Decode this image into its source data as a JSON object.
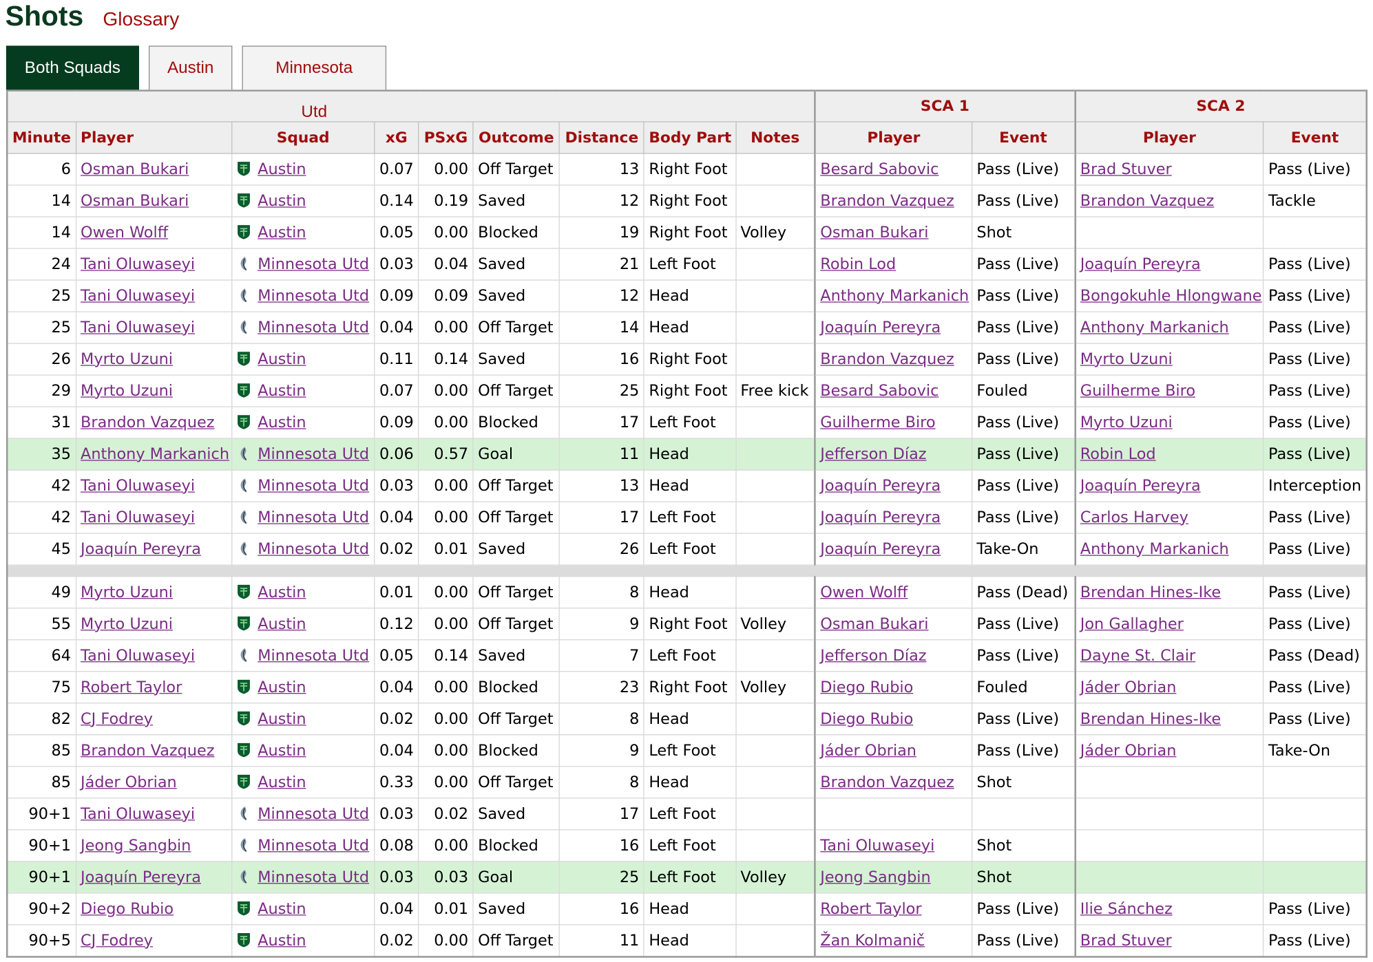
{
  "header": {
    "title": "Shots",
    "glossary": "Glossary"
  },
  "tabs": [
    "Both Squads",
    "Austin",
    "Minnesota Utd"
  ],
  "table": {
    "groups": {
      "sca1": "SCA 1",
      "sca2": "SCA 2"
    },
    "columns": [
      "Minute",
      "Player",
      "Squad",
      "xG",
      "PSxG",
      "Outcome",
      "Distance",
      "Body Part",
      "Notes",
      "Player",
      "Event",
      "Player",
      "Event"
    ],
    "colors": {
      "austin": "#0b5b2e",
      "minnesota": "#8a9aa8",
      "goal_row": "#d5f2d5"
    },
    "rows_first_half": [
      {
        "minute": "6",
        "player": "Osman Bukari",
        "squad": "Austin",
        "xg": "0.07",
        "psxg": "0.00",
        "outcome": "Off Target",
        "distance": "13",
        "body": "Right Foot",
        "notes": "",
        "sca1_player": "Besard Sabovic",
        "sca1_event": "Pass (Live)",
        "sca2_player": "Brad Stuver",
        "sca2_event": "Pass (Live)"
      },
      {
        "minute": "14",
        "player": "Osman Bukari",
        "squad": "Austin",
        "xg": "0.14",
        "psxg": "0.19",
        "outcome": "Saved",
        "distance": "12",
        "body": "Right Foot",
        "notes": "",
        "sca1_player": "Brandon Vazquez",
        "sca1_event": "Pass (Live)",
        "sca2_player": "Brandon Vazquez",
        "sca2_event": "Tackle"
      },
      {
        "minute": "14",
        "player": "Owen Wolff",
        "squad": "Austin",
        "xg": "0.05",
        "psxg": "0.00",
        "outcome": "Blocked",
        "distance": "19",
        "body": "Right Foot",
        "notes": "Volley",
        "sca1_player": "Osman Bukari",
        "sca1_event": "Shot",
        "sca2_player": "",
        "sca2_event": ""
      },
      {
        "minute": "24",
        "player": "Tani Oluwaseyi",
        "squad": "Minnesota Utd",
        "xg": "0.03",
        "psxg": "0.04",
        "outcome": "Saved",
        "distance": "21",
        "body": "Left Foot",
        "notes": "",
        "sca1_player": "Robin Lod",
        "sca1_event": "Pass (Live)",
        "sca2_player": "Joaquín Pereyra",
        "sca2_event": "Pass (Live)"
      },
      {
        "minute": "25",
        "player": "Tani Oluwaseyi",
        "squad": "Minnesota Utd",
        "xg": "0.09",
        "psxg": "0.09",
        "outcome": "Saved",
        "distance": "12",
        "body": "Head",
        "notes": "",
        "sca1_player": "Anthony Markanich",
        "sca1_event": "Pass (Live)",
        "sca2_player": "Bongokuhle Hlongwane",
        "sca2_event": "Pass (Live)"
      },
      {
        "minute": "25",
        "player": "Tani Oluwaseyi",
        "squad": "Minnesota Utd",
        "xg": "0.04",
        "psxg": "0.00",
        "outcome": "Off Target",
        "distance": "14",
        "body": "Head",
        "notes": "",
        "sca1_player": "Joaquín Pereyra",
        "sca1_event": "Pass (Live)",
        "sca2_player": "Anthony Markanich",
        "sca2_event": "Pass (Live)"
      },
      {
        "minute": "26",
        "player": "Myrto Uzuni",
        "squad": "Austin",
        "xg": "0.11",
        "psxg": "0.14",
        "outcome": "Saved",
        "distance": "16",
        "body": "Right Foot",
        "notes": "",
        "sca1_player": "Brandon Vazquez",
        "sca1_event": "Pass (Live)",
        "sca2_player": "Myrto Uzuni",
        "sca2_event": "Pass (Live)"
      },
      {
        "minute": "29",
        "player": "Myrto Uzuni",
        "squad": "Austin",
        "xg": "0.07",
        "psxg": "0.00",
        "outcome": "Off Target",
        "distance": "25",
        "body": "Right Foot",
        "notes": "Free kick",
        "sca1_player": "Besard Sabovic",
        "sca1_event": "Fouled",
        "sca2_player": "Guilherme Biro",
        "sca2_event": "Pass (Live)"
      },
      {
        "minute": "31",
        "player": "Brandon Vazquez",
        "squad": "Austin",
        "xg": "0.09",
        "psxg": "0.00",
        "outcome": "Blocked",
        "distance": "17",
        "body": "Left Foot",
        "notes": "",
        "sca1_player": "Guilherme Biro",
        "sca1_event": "Pass (Live)",
        "sca2_player": "Myrto Uzuni",
        "sca2_event": "Pass (Live)"
      },
      {
        "minute": "35",
        "player": "Anthony Markanich",
        "squad": "Minnesota Utd",
        "xg": "0.06",
        "psxg": "0.57",
        "outcome": "Goal",
        "distance": "11",
        "body": "Head",
        "notes": "",
        "sca1_player": "Jefferson Díaz",
        "sca1_event": "Pass (Live)",
        "sca2_player": "Robin Lod",
        "sca2_event": "Pass (Live)"
      },
      {
        "minute": "42",
        "player": "Tani Oluwaseyi",
        "squad": "Minnesota Utd",
        "xg": "0.03",
        "psxg": "0.00",
        "outcome": "Off Target",
        "distance": "13",
        "body": "Head",
        "notes": "",
        "sca1_player": "Joaquín Pereyra",
        "sca1_event": "Pass (Live)",
        "sca2_player": "Joaquín Pereyra",
        "sca2_event": "Interception"
      },
      {
        "minute": "42",
        "player": "Tani Oluwaseyi",
        "squad": "Minnesota Utd",
        "xg": "0.04",
        "psxg": "0.00",
        "outcome": "Off Target",
        "distance": "17",
        "body": "Left Foot",
        "notes": "",
        "sca1_player": "Joaquín Pereyra",
        "sca1_event": "Pass (Live)",
        "sca2_player": "Carlos Harvey",
        "sca2_event": "Pass (Live)"
      },
      {
        "minute": "45",
        "player": "Joaquín Pereyra",
        "squad": "Minnesota Utd",
        "xg": "0.02",
        "psxg": "0.01",
        "outcome": "Saved",
        "distance": "26",
        "body": "Left Foot",
        "notes": "",
        "sca1_player": "Joaquín Pereyra",
        "sca1_event": "Take-On",
        "sca2_player": "Anthony Markanich",
        "sca2_event": "Pass (Live)"
      }
    ],
    "rows_second_half": [
      {
        "minute": "49",
        "player": "Myrto Uzuni",
        "squad": "Austin",
        "xg": "0.01",
        "psxg": "0.00",
        "outcome": "Off Target",
        "distance": "8",
        "body": "Head",
        "notes": "",
        "sca1_player": "Owen Wolff",
        "sca1_event": "Pass (Dead)",
        "sca2_player": "Brendan Hines-Ike",
        "sca2_event": "Pass (Live)"
      },
      {
        "minute": "55",
        "player": "Myrto Uzuni",
        "squad": "Austin",
        "xg": "0.12",
        "psxg": "0.00",
        "outcome": "Off Target",
        "distance": "9",
        "body": "Right Foot",
        "notes": "Volley",
        "sca1_player": "Osman Bukari",
        "sca1_event": "Pass (Live)",
        "sca2_player": "Jon Gallagher",
        "sca2_event": "Pass (Live)"
      },
      {
        "minute": "64",
        "player": "Tani Oluwaseyi",
        "squad": "Minnesota Utd",
        "xg": "0.05",
        "psxg": "0.14",
        "outcome": "Saved",
        "distance": "7",
        "body": "Left Foot",
        "notes": "",
        "sca1_player": "Jefferson Díaz",
        "sca1_event": "Pass (Live)",
        "sca2_player": "Dayne St. Clair",
        "sca2_event": "Pass (Dead)"
      },
      {
        "minute": "75",
        "player": "Robert Taylor",
        "squad": "Austin",
        "xg": "0.04",
        "psxg": "0.00",
        "outcome": "Blocked",
        "distance": "23",
        "body": "Right Foot",
        "notes": "Volley",
        "sca1_player": "Diego Rubio",
        "sca1_event": "Fouled",
        "sca2_player": "Jáder Obrian",
        "sca2_event": "Pass (Live)"
      },
      {
        "minute": "82",
        "player": "CJ Fodrey",
        "squad": "Austin",
        "xg": "0.02",
        "psxg": "0.00",
        "outcome": "Off Target",
        "distance": "8",
        "body": "Head",
        "notes": "",
        "sca1_player": "Diego Rubio",
        "sca1_event": "Pass (Live)",
        "sca2_player": "Brendan Hines-Ike",
        "sca2_event": "Pass (Live)"
      },
      {
        "minute": "85",
        "player": "Brandon Vazquez",
        "squad": "Austin",
        "xg": "0.04",
        "psxg": "0.00",
        "outcome": "Blocked",
        "distance": "9",
        "body": "Left Foot",
        "notes": "",
        "sca1_player": "Jáder Obrian",
        "sca1_event": "Pass (Live)",
        "sca2_player": "Jáder Obrian",
        "sca2_event": "Take-On"
      },
      {
        "minute": "85",
        "player": "Jáder Obrian",
        "squad": "Austin",
        "xg": "0.33",
        "psxg": "0.00",
        "outcome": "Off Target",
        "distance": "8",
        "body": "Head",
        "notes": "",
        "sca1_player": "Brandon Vazquez",
        "sca1_event": "Shot",
        "sca2_player": "",
        "sca2_event": ""
      },
      {
        "minute": "90+1",
        "player": "Tani Oluwaseyi",
        "squad": "Minnesota Utd",
        "xg": "0.03",
        "psxg": "0.02",
        "outcome": "Saved",
        "distance": "17",
        "body": "Left Foot",
        "notes": "",
        "sca1_player": "",
        "sca1_event": "",
        "sca2_player": "",
        "sca2_event": ""
      },
      {
        "minute": "90+1",
        "player": "Jeong Sangbin",
        "squad": "Minnesota Utd",
        "xg": "0.08",
        "psxg": "0.00",
        "outcome": "Blocked",
        "distance": "16",
        "body": "Left Foot",
        "notes": "",
        "sca1_player": "Tani Oluwaseyi",
        "sca1_event": "Shot",
        "sca2_player": "",
        "sca2_event": ""
      },
      {
        "minute": "90+1",
        "player": "Joaquín Pereyra",
        "squad": "Minnesota Utd",
        "xg": "0.03",
        "psxg": "0.03",
        "outcome": "Goal",
        "distance": "25",
        "body": "Left Foot",
        "notes": "Volley",
        "sca1_player": "Jeong Sangbin",
        "sca1_event": "Shot",
        "sca2_player": "",
        "sca2_event": ""
      },
      {
        "minute": "90+2",
        "player": "Diego Rubio",
        "squad": "Austin",
        "xg": "0.04",
        "psxg": "0.01",
        "outcome": "Saved",
        "distance": "16",
        "body": "Head",
        "notes": "",
        "sca1_player": "Robert Taylor",
        "sca1_event": "Pass (Live)",
        "sca2_player": "Ilie Sánchez",
        "sca2_event": "Pass (Live)"
      },
      {
        "minute": "90+5",
        "player": "CJ Fodrey",
        "squad": "Austin",
        "xg": "0.02",
        "psxg": "0.00",
        "outcome": "Off Target",
        "distance": "11",
        "body": "Head",
        "notes": "",
        "sca1_player": "Žan Kolmanič",
        "sca1_event": "Pass (Live)",
        "sca2_player": "Brad Stuver",
        "sca2_event": "Pass (Live)"
      }
    ]
  }
}
